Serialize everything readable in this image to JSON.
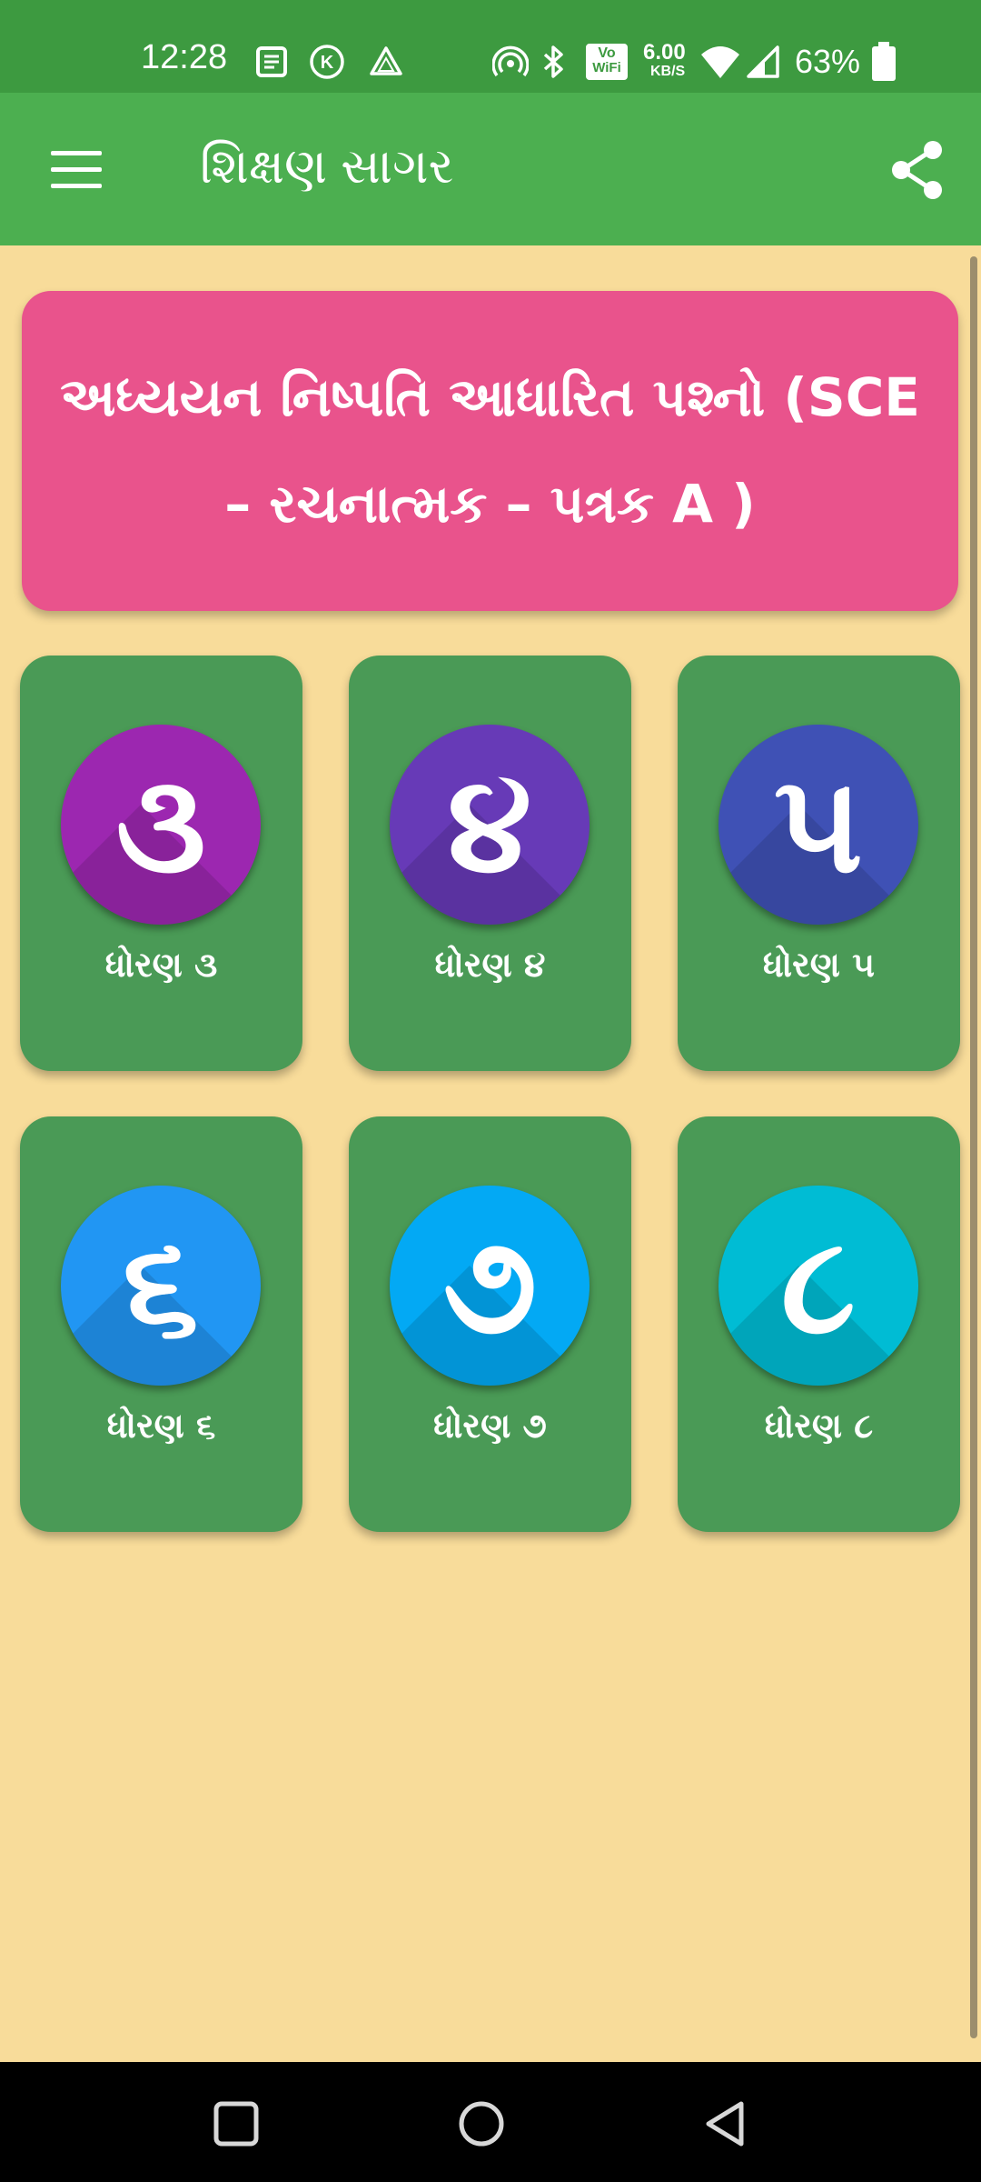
{
  "status_bar": {
    "time": "12:28",
    "net_speed_value": "6.00",
    "net_speed_unit": "KB/S",
    "battery": "63%",
    "icons": [
      "news-icon",
      "k-circle-icon",
      "drive-icon",
      "hotspot-icon",
      "bluetooth-icon",
      "vowifi-icon",
      "wifi-icon",
      "signal-icon",
      "battery-icon"
    ],
    "volte_top": "Vo",
    "volte_bottom": "WiFi",
    "k_letter": "K"
  },
  "app_bar": {
    "title": "શિક્ષણ સાગર",
    "menu_icon": "menu-icon",
    "share_icon": "share-icon"
  },
  "banner": {
    "title": "અધ્યયન નિષ્પતિ આધારિત પશ્નો (SCE – રચનાત્મક – પત્રક A )"
  },
  "grades": [
    {
      "numeral": "૩",
      "label": "ધોરણ ૩",
      "color": "#9c27b0"
    },
    {
      "numeral": "૪",
      "label": "ધોરણ ૪",
      "color": "#673ab7"
    },
    {
      "numeral": "૫",
      "label": "ધોરણ ૫",
      "color": "#3f51b5"
    },
    {
      "numeral": "૬",
      "label": "ધોરણ ૬",
      "color": "#2196f3"
    },
    {
      "numeral": "૭",
      "label": "ધોરણ ૭",
      "color": "#03a9f4"
    },
    {
      "numeral": "૮",
      "label": "ધોરણ ૮",
      "color": "#00bcd4"
    }
  ],
  "colors": {
    "status_bar": "#3d9a40",
    "app_bar": "#4caf50",
    "background": "#f8dc9a",
    "banner": "#e9538c",
    "card": "#4a9a56"
  },
  "nav_bar": {
    "icons": [
      "recents-square-icon",
      "home-circle-icon",
      "back-triangle-icon"
    ]
  }
}
